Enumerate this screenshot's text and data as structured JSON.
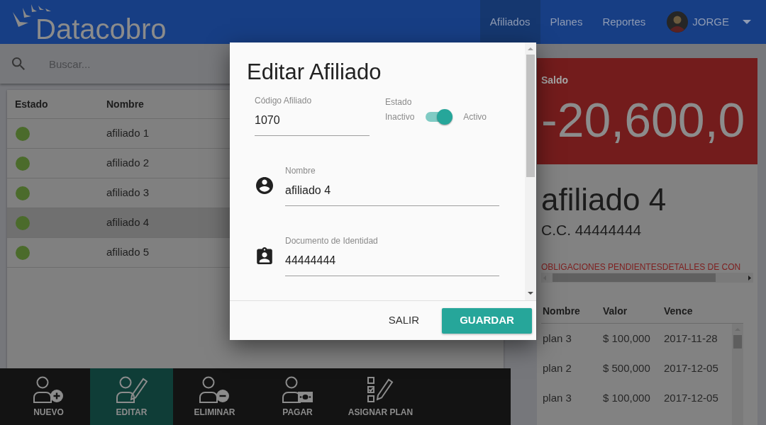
{
  "header": {
    "logo": "**Data**cobro",
    "nav": [
      {
        "label": "Afiliados",
        "selected": true
      },
      {
        "label": "Planes",
        "selected": false
      },
      {
        "label": "Reportes",
        "selected": false
      }
    ],
    "user": {
      "name": "JORGE"
    }
  },
  "search": {
    "placeholder": "Buscar..."
  },
  "affiliates_table": {
    "columns": [
      "Estado",
      "Nombre"
    ],
    "rows": [
      {
        "color": "#4b6b2b",
        "name": "afiliado 1",
        "selected": false
      },
      {
        "color": "#4b6b2b",
        "name": "afiliado 2",
        "selected": false
      },
      {
        "color": "#4b6b2b",
        "name": "afiliado 3",
        "selected": false
      },
      {
        "color": "#4b6b2b",
        "name": "afiliado 4",
        "selected": true
      },
      {
        "color": "#4b6b2b",
        "name": "afiliado 5",
        "selected": false
      }
    ]
  },
  "toolbar": [
    {
      "kind": "add",
      "label": "NUEVO",
      "selected": false
    },
    {
      "kind": "edit",
      "label": "EDITAR",
      "selected": true
    },
    {
      "kind": "remove",
      "label": "ELIMINAR",
      "selected": false
    },
    {
      "kind": "pay",
      "label": "PAGAR",
      "selected": false
    },
    {
      "kind": "assign",
      "label": "ASIGNAR PLAN",
      "selected": false
    }
  ],
  "balance": {
    "label": "Saldo",
    "amount": "-20,600,0"
  },
  "affiliate": {
    "name": "afiliado 4",
    "document": "C.C. 44444444"
  },
  "detail_tabs": [
    "OBLIGACIONES PENDIENTES",
    "DETALLES DE CON"
  ],
  "obligations_table": {
    "columns": [
      "Nombre",
      "Valor",
      "Vence"
    ],
    "rows": [
      [
        "plan 3",
        "$ 100,000",
        "2017-11-28"
      ],
      [
        "plan 2",
        "$ 500,000",
        "2017-12-05"
      ],
      [
        "plan 3",
        "$ 100,000",
        "2017-12-05"
      ]
    ]
  },
  "dialog": {
    "title": "Editar Afiliado",
    "code_field": {
      "label": "Código Afiliado",
      "value": "1070"
    },
    "status": {
      "label": "Estado",
      "off_label": "Inactivo",
      "on_label": "Activo",
      "on": true
    },
    "fields": [
      {
        "kind": "person",
        "label": "Nombre",
        "value": "afiliado 4"
      },
      {
        "kind": "badge",
        "label": "Documento de Identidad",
        "value": "44444444"
      }
    ],
    "buttons": [
      {
        "kind": "text",
        "label": "SALIR"
      },
      {
        "kind": "primary",
        "label": "GUARDAR"
      }
    ]
  }
}
